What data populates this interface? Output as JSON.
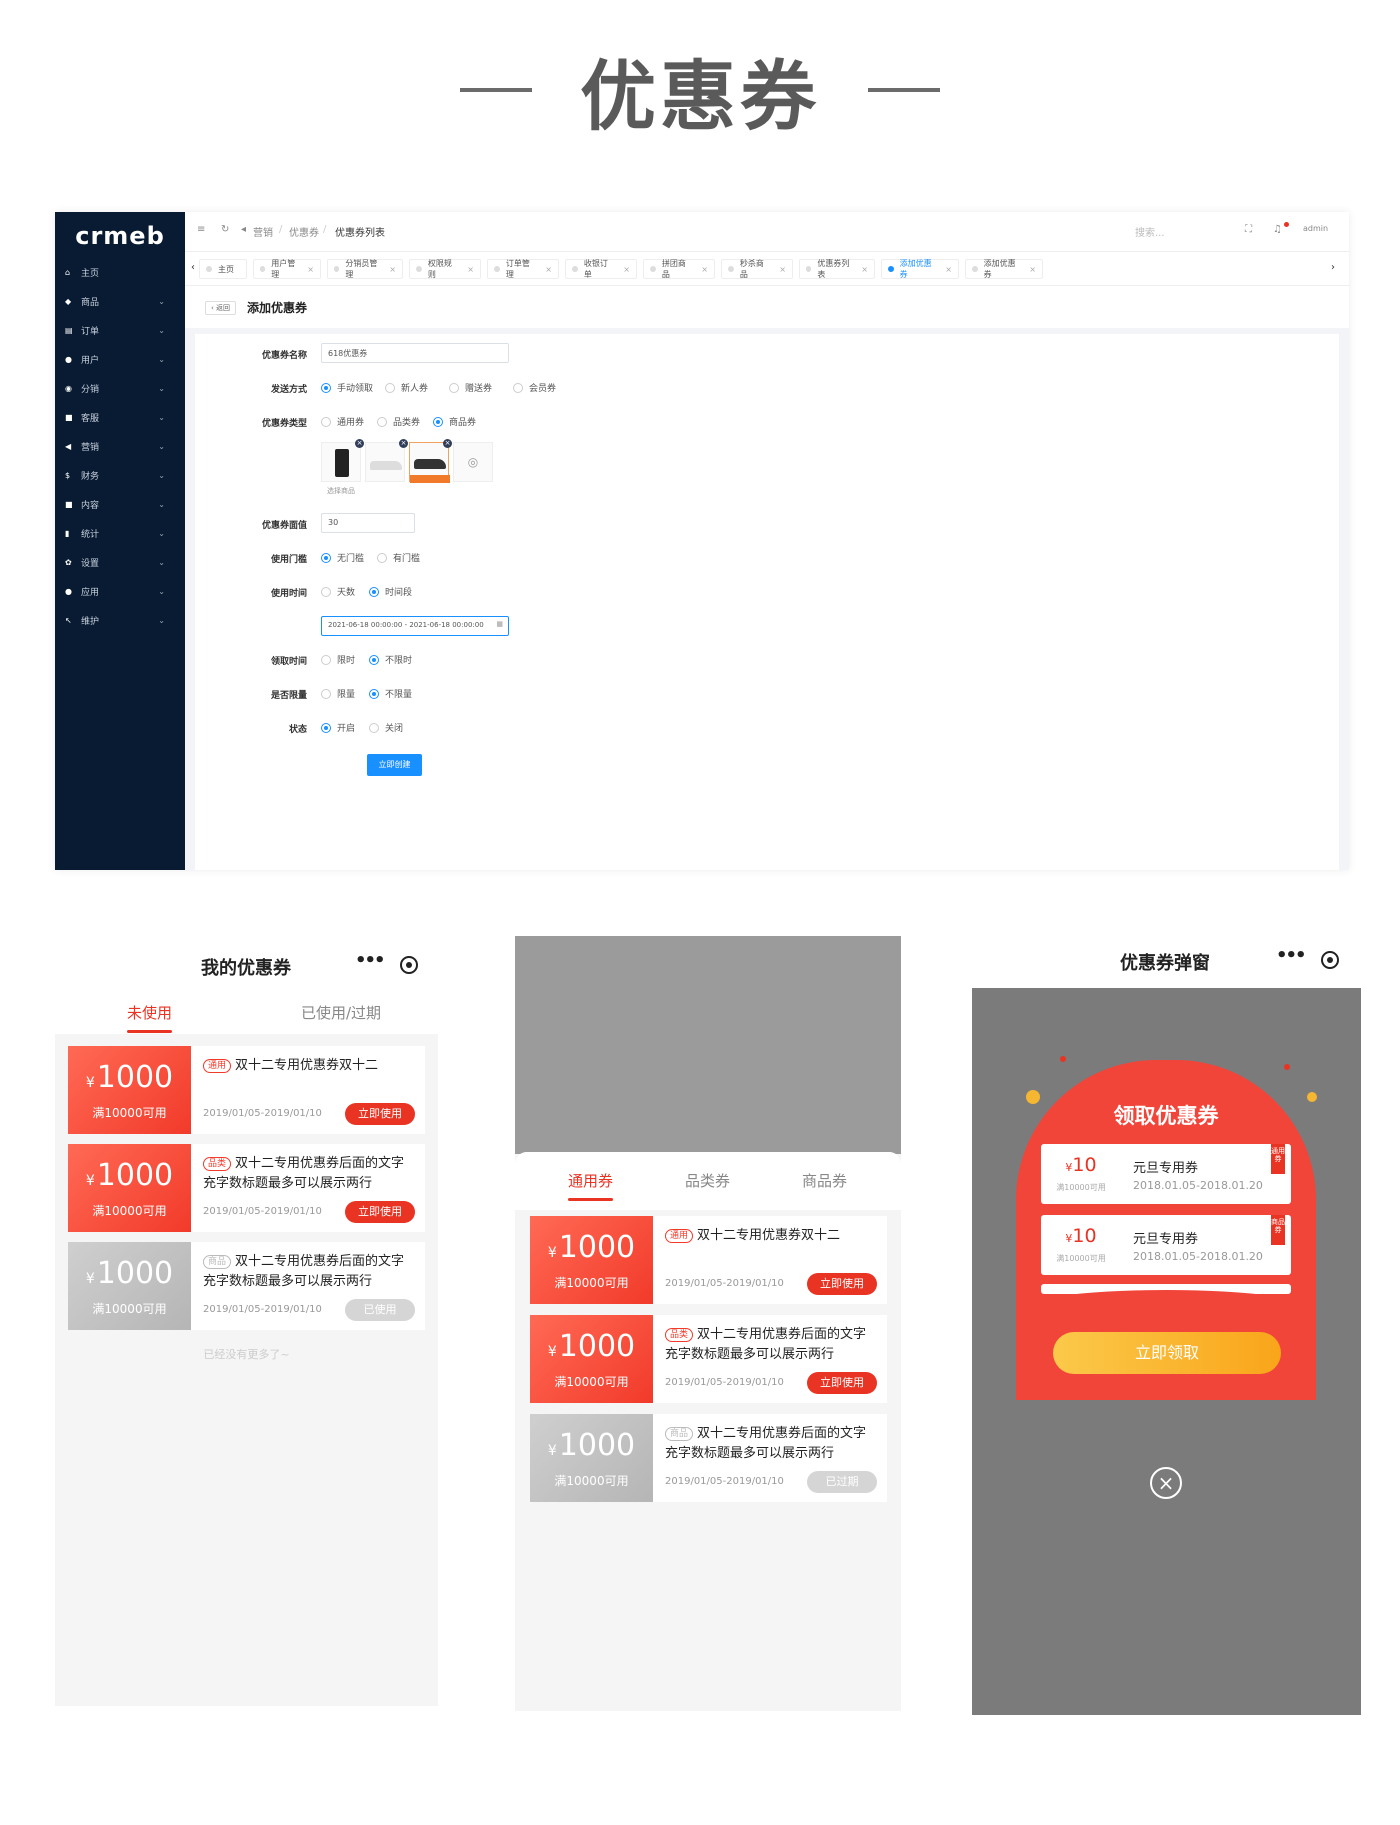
{
  "hero": {
    "title": "优惠券"
  },
  "admin": {
    "logo": "crmeb",
    "sidebar": [
      {
        "icon": "home-icon",
        "glyph": "⌂",
        "label": "主页",
        "chev": ""
      },
      {
        "icon": "goods-icon",
        "glyph": "◆",
        "label": "商品",
        "chev": "⌄"
      },
      {
        "icon": "order-icon",
        "glyph": "▤",
        "label": "订单",
        "chev": "⌄"
      },
      {
        "icon": "user-icon",
        "glyph": "●",
        "label": "用户",
        "chev": "⌄"
      },
      {
        "icon": "distribution-icon",
        "glyph": "◉",
        "label": "分销",
        "chev": "⌄"
      },
      {
        "icon": "service-icon",
        "glyph": "■",
        "label": "客服",
        "chev": "⌄"
      },
      {
        "icon": "marketing-icon",
        "glyph": "◀",
        "label": "营销",
        "chev": "⌄"
      },
      {
        "icon": "finance-icon",
        "glyph": "$",
        "label": "财务",
        "chev": "⌄"
      },
      {
        "icon": "content-icon",
        "glyph": "■",
        "label": "内容",
        "chev": "⌄"
      },
      {
        "icon": "stats-icon",
        "glyph": "▮",
        "label": "统计",
        "chev": "⌄"
      },
      {
        "icon": "settings-icon",
        "glyph": "✿",
        "label": "设置",
        "chev": "⌄"
      },
      {
        "icon": "apps-icon",
        "glyph": "●",
        "label": "应用",
        "chev": "⌄"
      },
      {
        "icon": "maintain-icon",
        "glyph": "↖",
        "label": "维护",
        "chev": "⌄"
      }
    ],
    "breadcrumb": {
      "b1": "营销",
      "sep": "/",
      "b2": "优惠券",
      "b3": "优惠券列表"
    },
    "search_placeholder": "搜索...",
    "user": "admin",
    "tabs": [
      "主页",
      "用户管理",
      "分销员管理",
      "权限规则",
      "订单管理",
      "收银订单",
      "拼团商品",
      "秒杀商品",
      "优惠券列表",
      "添加优惠券",
      "添加优惠券"
    ],
    "back_label": "返回",
    "page_title": "添加优惠券",
    "form": {
      "name_label": "优惠券名称",
      "name_value": "618优惠券",
      "send_label": "发送方式",
      "send_opts": [
        "手动领取",
        "新人券",
        "赠送券",
        "会员券"
      ],
      "type_label": "优惠券类型",
      "type_opts": [
        "通用券",
        "品类券",
        "商品券"
      ],
      "select_goods": "选择商品",
      "value_label": "优惠券面值",
      "value_value": "30",
      "threshold_label": "使用门槛",
      "threshold_opts": [
        "无门槛",
        "有门槛"
      ],
      "usetime_label": "使用时间",
      "usetime_opts": [
        "天数",
        "时间段"
      ],
      "date_range": "2021-06-18 00:00:00 - 2021-06-18 00:00:00",
      "receive_label": "领取时间",
      "receive_opts": [
        "限时",
        "不限时"
      ],
      "limit_label": "是否限量",
      "limit_opts": [
        "限量",
        "不限量"
      ],
      "status_label": "状态",
      "status_opts": [
        "开启",
        "关闭"
      ],
      "submit": "立即创建"
    }
  },
  "phone1": {
    "title": "我的优惠券",
    "tabs": [
      "未使用",
      "已使用/过期"
    ],
    "coupons": [
      {
        "amount": "1000",
        "currency": "¥",
        "min": "满10000可用",
        "tag": "通用",
        "title": "双十二专用优惠券双十二",
        "date": "2019/01/05-2019/01/10",
        "btn": "立即使用"
      },
      {
        "amount": "1000",
        "currency": "¥",
        "min": "满10000可用",
        "tag": "品类",
        "title": "双十二专用优惠券后面的文字充字数标题最多可以展示两行",
        "date": "2019/01/05-2019/01/10",
        "btn": "立即使用"
      },
      {
        "amount": "1000",
        "currency": "¥",
        "min": "满10000可用",
        "tag": "商品",
        "title": "双十二专用优惠券后面的文字充字数标题最多可以展示两行",
        "date": "2019/01/05-2019/01/10",
        "btn": "已使用"
      }
    ],
    "footer": "已经没有更多了~"
  },
  "phone2": {
    "tabs": [
      "通用券",
      "品类券",
      "商品券"
    ],
    "coupons": [
      {
        "amount": "1000",
        "currency": "¥",
        "min": "满10000可用",
        "tag": "通用",
        "title": "双十二专用优惠券双十二",
        "date": "2019/01/05-2019/01/10",
        "btn": "立即使用"
      },
      {
        "amount": "1000",
        "currency": "¥",
        "min": "满10000可用",
        "tag": "品类",
        "title": "双十二专用优惠券后面的文字充字数标题最多可以展示两行",
        "date": "2019/01/05-2019/01/10",
        "btn": "立即使用"
      },
      {
        "amount": "1000",
        "currency": "¥",
        "min": "满10000可用",
        "tag": "商品",
        "title": "双十二专用优惠券后面的文字充字数标题最多可以展示两行",
        "date": "2019/01/05-2019/01/10",
        "btn": "已过期"
      }
    ]
  },
  "phone3": {
    "title": "优惠券弹窗",
    "heading": "领取优惠券",
    "coupons": [
      {
        "amount": "10",
        "currency": "¥",
        "min": "满10000可用",
        "name": "元旦专用券",
        "date": "2018.01.05-2018.01.20",
        "badge": "通用券"
      },
      {
        "amount": "10",
        "currency": "¥",
        "min": "满10000可用",
        "name": "元旦专用券",
        "date": "2018.01.05-2018.01.20",
        "badge": "商品券"
      }
    ],
    "button": "立即领取",
    "close": "×"
  },
  "colors": {
    "accent": "#e93323",
    "primary": "#1890ff",
    "sidebar": "#081b33"
  }
}
